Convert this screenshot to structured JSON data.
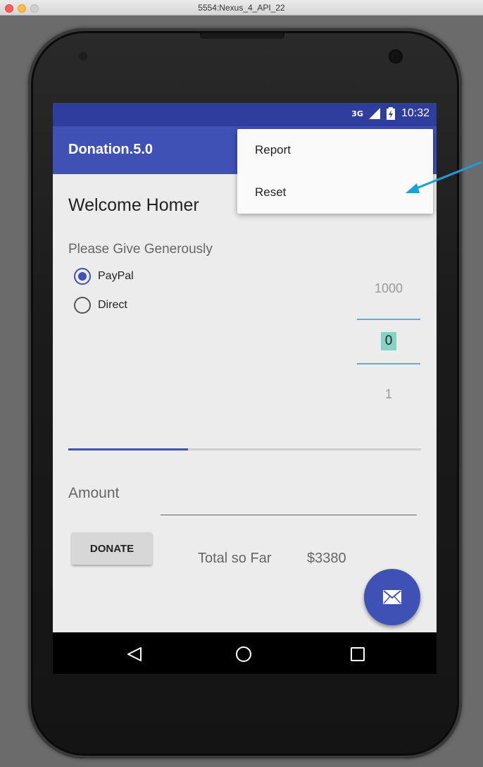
{
  "window": {
    "title": "5554:Nexus_4_API_22"
  },
  "status_bar": {
    "network": "3G",
    "time": "10:32"
  },
  "app_bar": {
    "title": "Donation.5.0"
  },
  "overflow_menu": {
    "items": [
      "Report",
      "Reset"
    ]
  },
  "main": {
    "welcome": "Welcome Homer",
    "give_label": "Please Give Generously",
    "payment_options": [
      {
        "label": "PayPal",
        "selected": true
      },
      {
        "label": "Direct",
        "selected": false
      }
    ],
    "picker": {
      "above": "1000",
      "current": "0",
      "below": "1"
    },
    "progress_fraction": 0.34,
    "amount_label": "Amount",
    "amount_value": "",
    "donate_label": "DONATE",
    "total_label": "Total so Far",
    "total_value": "$3380"
  },
  "colors": {
    "primary": "#3f51b5",
    "primary_dark": "#2f3e9e",
    "accent_line": "#4fb3e0",
    "annotation_arrow": "#1a9fdd"
  },
  "icons": {
    "fab": "mail-icon",
    "nav": [
      "back-triangle-icon",
      "home-circle-icon",
      "recent-square-icon"
    ]
  }
}
